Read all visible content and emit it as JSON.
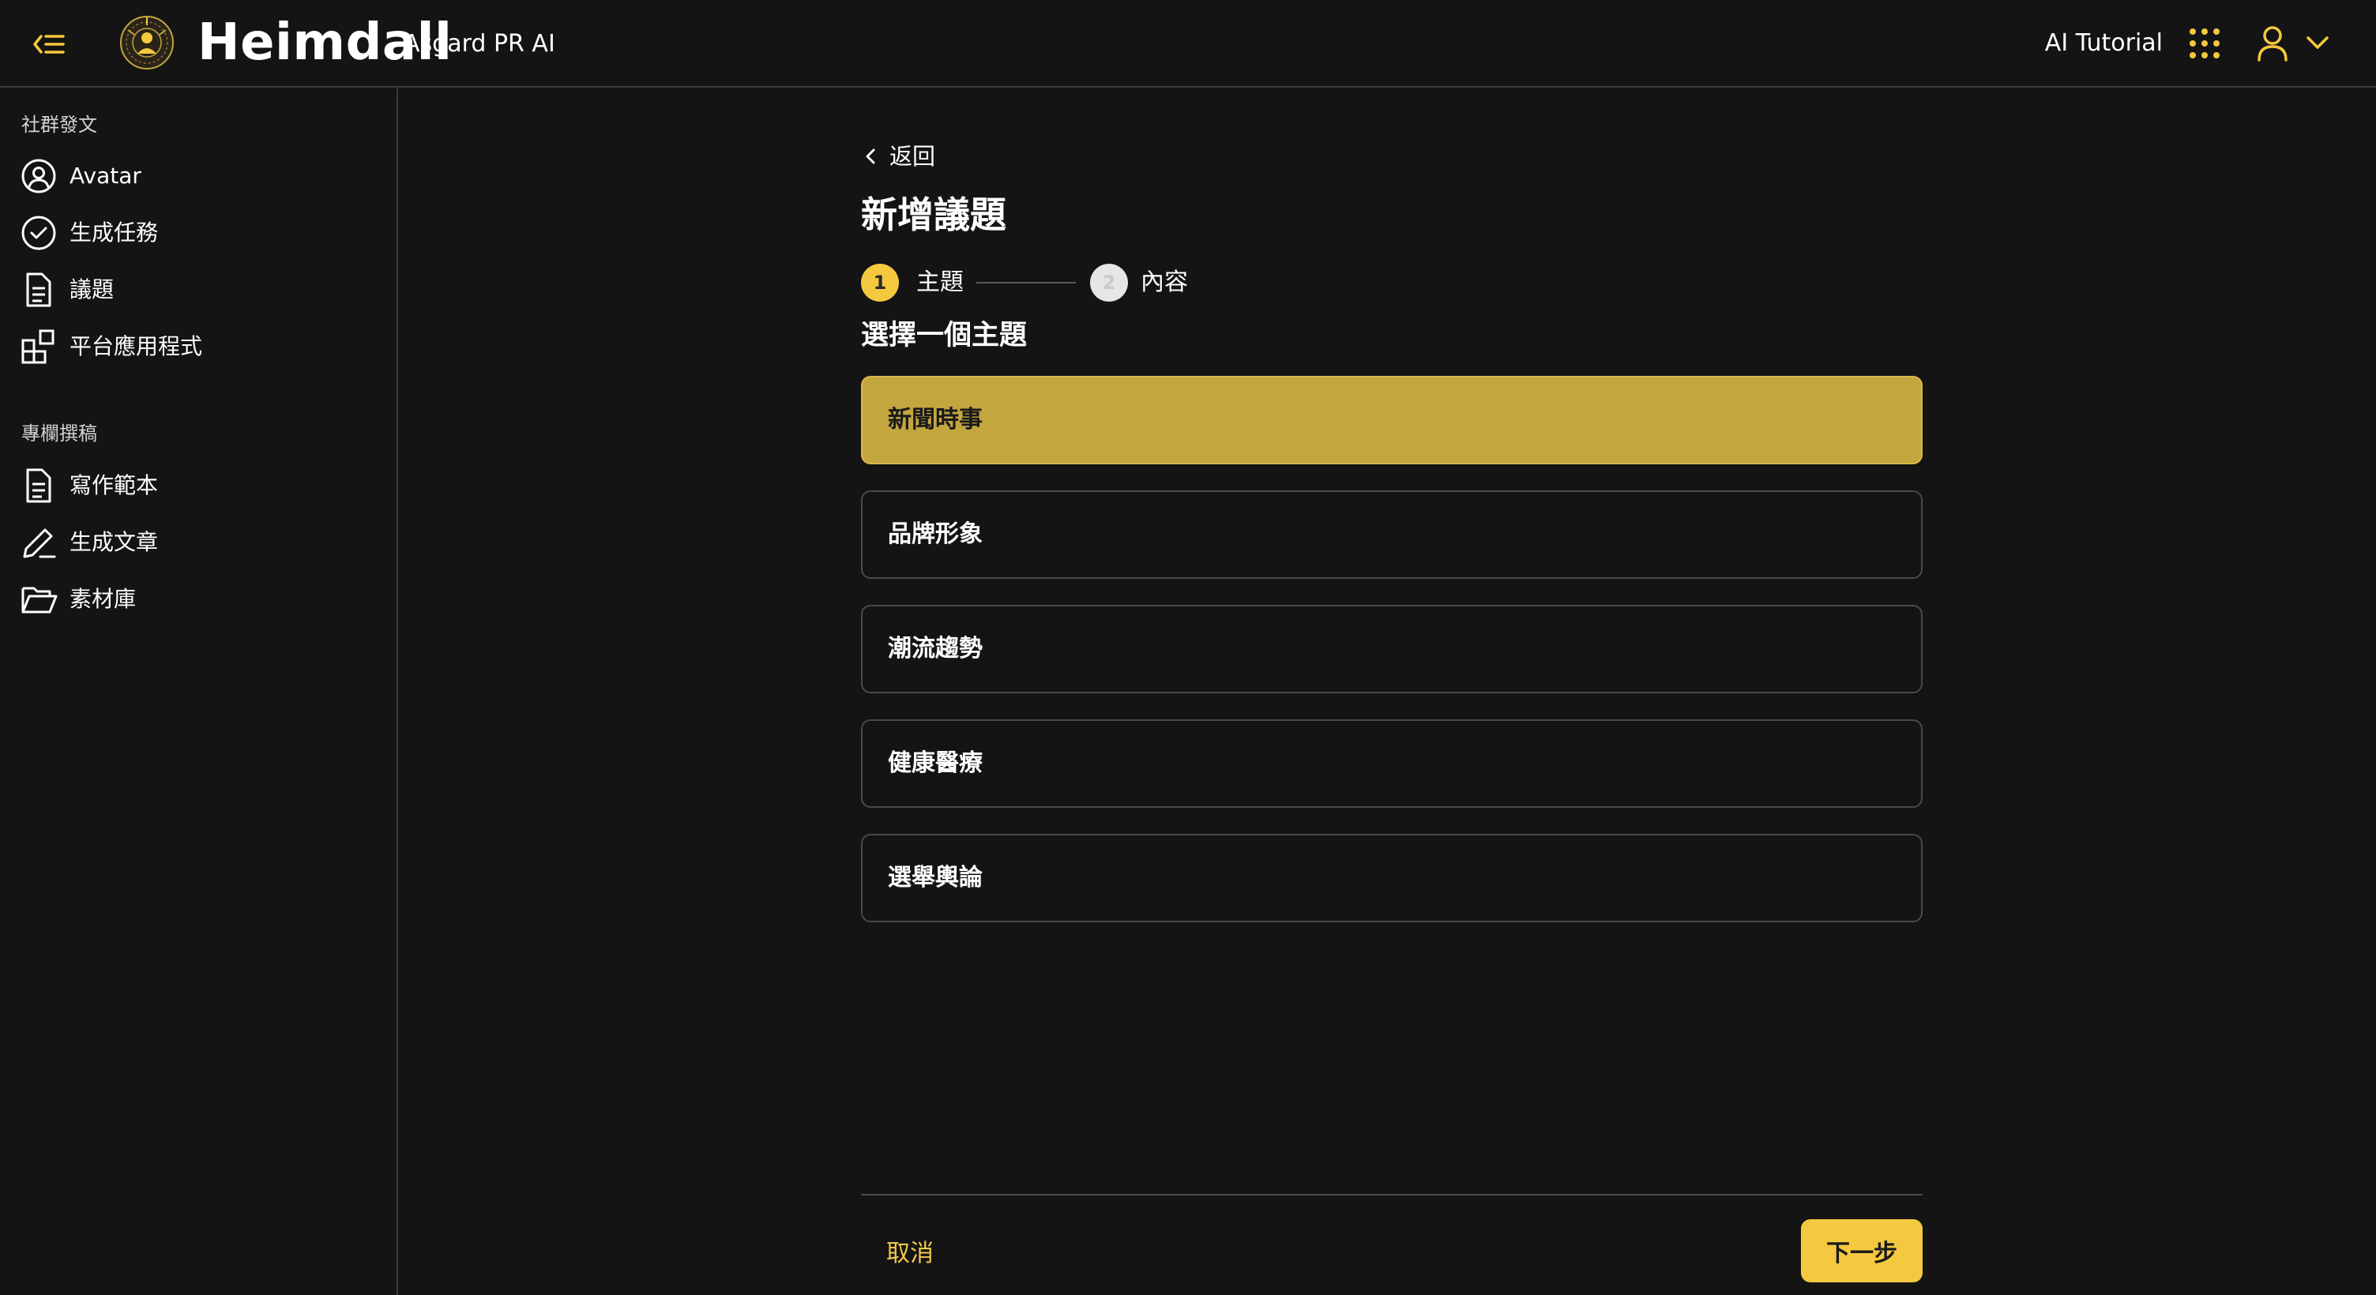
{
  "header": {
    "app_name": "Heimdall",
    "app_subtitle": "Asgard PR AI",
    "tutorial_label": "AI Tutorial"
  },
  "sidebar": {
    "sections": [
      {
        "label": "社群發文",
        "items": [
          {
            "label": "Avatar",
            "icon": "user-circle-icon"
          },
          {
            "label": "生成任務",
            "icon": "check-circle-icon"
          },
          {
            "label": "議題",
            "icon": "document-icon"
          },
          {
            "label": "平台應用程式",
            "icon": "apps-grid-icon"
          }
        ]
      },
      {
        "label": "專欄撰稿",
        "items": [
          {
            "label": "寫作範本",
            "icon": "document-icon"
          },
          {
            "label": "生成文章",
            "icon": "pencil-icon"
          },
          {
            "label": "素材庫",
            "icon": "folder-open-icon"
          }
        ]
      }
    ]
  },
  "main": {
    "back_label": "返回",
    "title": "新增議題",
    "stepper": {
      "steps": [
        {
          "number": "1",
          "label": "主題",
          "state": "active"
        },
        {
          "number": "2",
          "label": "內容",
          "state": "inactive"
        }
      ]
    },
    "section_heading": "選擇一個主題",
    "topics": [
      {
        "label": "新聞時事",
        "selected": true
      },
      {
        "label": "品牌形象",
        "selected": false
      },
      {
        "label": "潮流趨勢",
        "selected": false
      },
      {
        "label": "健康醫療",
        "selected": false
      },
      {
        "label": "選舉輿論",
        "selected": false
      }
    ],
    "footer": {
      "cancel_label": "取消",
      "next_label": "下一步"
    }
  },
  "colors": {
    "accent": "#f5c93f",
    "selected_option": "#c4a63f",
    "background": "#141414",
    "border": "#4a4a4a"
  }
}
